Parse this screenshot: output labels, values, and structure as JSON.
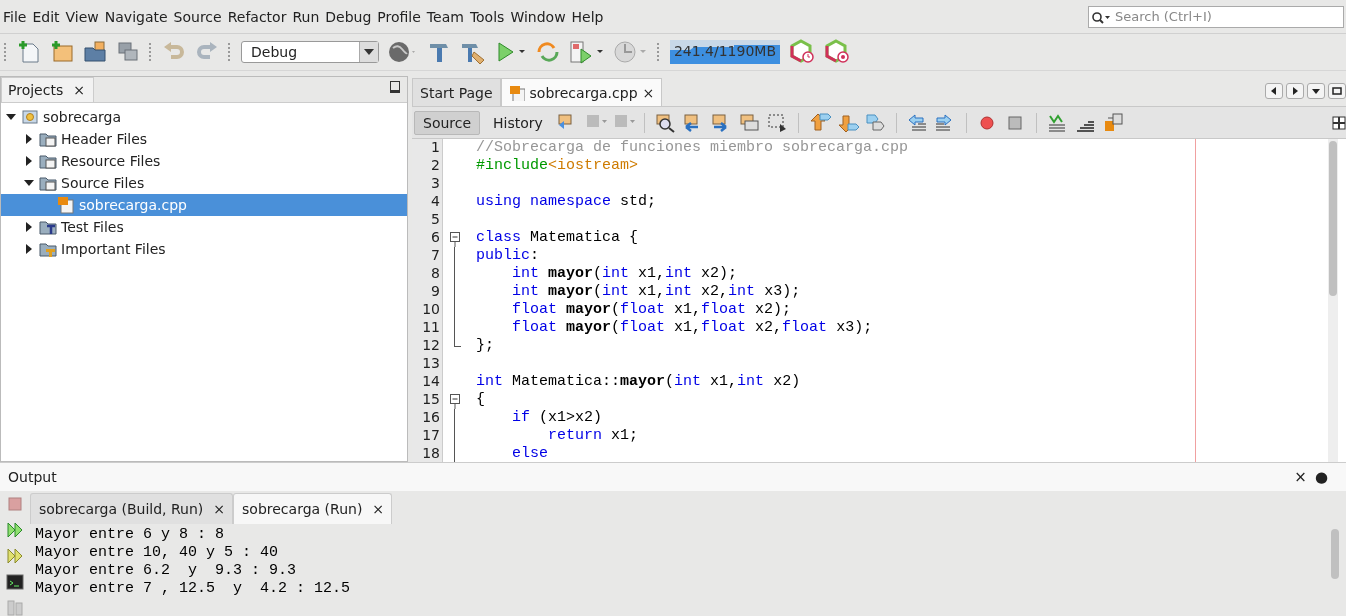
{
  "menu": [
    "File",
    "Edit",
    "View",
    "Navigate",
    "Source",
    "Refactor",
    "Run",
    "Debug",
    "Profile",
    "Team",
    "Tools",
    "Window",
    "Help"
  ],
  "search": {
    "placeholder": "Search (Ctrl+I)"
  },
  "toolbar": {
    "configuration": "Debug",
    "memory": "241.4/1190MB"
  },
  "projects": {
    "title": "Projects",
    "close": "×",
    "tree": [
      {
        "label": "sobrecarga",
        "kind": "project",
        "expanded": true,
        "selected": false,
        "children": [
          {
            "label": "Header Files",
            "kind": "folder",
            "expanded": false,
            "selected": false
          },
          {
            "label": "Resource Files",
            "kind": "folder",
            "expanded": false,
            "selected": false
          },
          {
            "label": "Source Files",
            "kind": "folder",
            "expanded": true,
            "selected": false,
            "children": [
              {
                "label": "sobrecarga.cpp",
                "kind": "cppfile",
                "selected": true
              }
            ]
          },
          {
            "label": "Test Files",
            "kind": "testfolder",
            "expanded": false,
            "selected": false
          },
          {
            "label": "Important Files",
            "kind": "importantfolder",
            "expanded": false,
            "selected": false
          }
        ]
      }
    ]
  },
  "editor_tabs": [
    {
      "label": "Start Page",
      "selected": false
    },
    {
      "label": "sobrecarga.cpp",
      "selected": true,
      "close": "×"
    }
  ],
  "editor_views": [
    {
      "label": "Source",
      "selected": true
    },
    {
      "label": "History",
      "selected": false
    }
  ],
  "code": [
    {
      "n": "1",
      "tokens": [
        {
          "kind": "comment",
          "text": "//Sobrecarga de funciones miembro sobrecarga.cpp"
        }
      ]
    },
    {
      "n": "2",
      "tokens": [
        {
          "kind": "pp",
          "text": "#include"
        },
        {
          "kind": "ppstr",
          "text": "<iostream>"
        }
      ]
    },
    {
      "n": "3"
    },
    {
      "n": "4",
      "tokens": [
        {
          "kind": "kw",
          "text": "using "
        },
        {
          "kind": "kw",
          "text": "namespace"
        },
        {
          "kind": "plain",
          "text": " std;"
        }
      ]
    },
    {
      "n": "5"
    },
    {
      "n": "6",
      "fold": {
        "kind": "start"
      },
      "tokens": [
        {
          "kind": "kw",
          "text": "class"
        },
        {
          "kind": "plain",
          "text": " Matematica {"
        }
      ]
    },
    {
      "n": "7",
      "fold": {
        "kind": "mid"
      },
      "tokens": [
        {
          "kind": "kw",
          "text": "public"
        },
        {
          "kind": "plain",
          "text": ":"
        }
      ]
    },
    {
      "n": "8",
      "fold": {
        "kind": "mid"
      },
      "tokens": [
        {
          "kind": "kw",
          "text": "    int "
        },
        {
          "kind": "bold",
          "text": "mayor"
        },
        {
          "kind": "plain",
          "text": "("
        },
        {
          "kind": "kw",
          "text": "int"
        },
        {
          "kind": "plain",
          "text": " x1,"
        },
        {
          "kind": "kw",
          "text": "int"
        },
        {
          "kind": "plain",
          "text": " x2);"
        }
      ]
    },
    {
      "n": "9",
      "fold": {
        "kind": "mid"
      },
      "tokens": [
        {
          "kind": "kw",
          "text": "    int "
        },
        {
          "kind": "bold",
          "text": "mayor"
        },
        {
          "kind": "plain",
          "text": "("
        },
        {
          "kind": "kw",
          "text": "int"
        },
        {
          "kind": "plain",
          "text": " x1,"
        },
        {
          "kind": "kw",
          "text": "int"
        },
        {
          "kind": "plain",
          "text": " x2,"
        },
        {
          "kind": "kw",
          "text": "int"
        },
        {
          "kind": "plain",
          "text": " x3);"
        }
      ]
    },
    {
      "n": "10",
      "fold": {
        "kind": "mid"
      },
      "tokens": [
        {
          "kind": "kw",
          "text": "    float "
        },
        {
          "kind": "bold",
          "text": "mayor"
        },
        {
          "kind": "plain",
          "text": "("
        },
        {
          "kind": "kw",
          "text": "float"
        },
        {
          "kind": "plain",
          "text": " x1,"
        },
        {
          "kind": "kw",
          "text": "float"
        },
        {
          "kind": "plain",
          "text": " x2);"
        }
      ]
    },
    {
      "n": "11",
      "fold": {
        "kind": "mid"
      },
      "tokens": [
        {
          "kind": "kw",
          "text": "    float "
        },
        {
          "kind": "bold",
          "text": "mayor"
        },
        {
          "kind": "plain",
          "text": "("
        },
        {
          "kind": "kw",
          "text": "float"
        },
        {
          "kind": "plain",
          "text": " x1,"
        },
        {
          "kind": "kw",
          "text": "float"
        },
        {
          "kind": "plain",
          "text": " x2,"
        },
        {
          "kind": "kw",
          "text": "float"
        },
        {
          "kind": "plain",
          "text": " x3);"
        }
      ]
    },
    {
      "n": "12",
      "fold": {
        "kind": "end"
      },
      "tokens": [
        {
          "kind": "plain",
          "text": "};"
        }
      ]
    },
    {
      "n": "13"
    },
    {
      "n": "14",
      "tokens": [
        {
          "kind": "kw",
          "text": "int"
        },
        {
          "kind": "plain",
          "text": " Matematica::"
        },
        {
          "kind": "bold",
          "text": "mayor"
        },
        {
          "kind": "plain",
          "text": "("
        },
        {
          "kind": "kw",
          "text": "int"
        },
        {
          "kind": "plain",
          "text": " x1,"
        },
        {
          "kind": "kw",
          "text": "int"
        },
        {
          "kind": "plain",
          "text": " x2)"
        }
      ]
    },
    {
      "n": "15",
      "fold": {
        "kind": "start"
      },
      "tokens": [
        {
          "kind": "plain",
          "text": "{"
        }
      ]
    },
    {
      "n": "16",
      "fold": {
        "kind": "mid"
      },
      "tokens": [
        {
          "kind": "kw",
          "text": "    if"
        },
        {
          "kind": "plain",
          "text": " (x1>x2)"
        }
      ]
    },
    {
      "n": "17",
      "fold": {
        "kind": "mid"
      },
      "tokens": [
        {
          "kind": "kw",
          "text": "        return"
        },
        {
          "kind": "plain",
          "text": " x1;"
        }
      ]
    },
    {
      "n": "18",
      "fold": {
        "kind": "mid"
      },
      "tokens": [
        {
          "kind": "kw",
          "text": "    else"
        }
      ]
    }
  ],
  "output": {
    "title": "Output",
    "controls": [
      "×",
      "●"
    ],
    "tabs": [
      {
        "label": "sobrecarga (Build, Run)",
        "selected": false,
        "close": "×"
      },
      {
        "label": "sobrecarga (Run)",
        "selected": true,
        "close": "×"
      }
    ],
    "lines": [
      "Mayor entre 6 y 8 : 8",
      "Mayor entre 10, 40 y 5 : 40",
      "Mayor entre 6.2  y  9.3 : 9.3",
      "Mayor entre 7 , 12.5  y  4.2 : 12.5"
    ]
  }
}
